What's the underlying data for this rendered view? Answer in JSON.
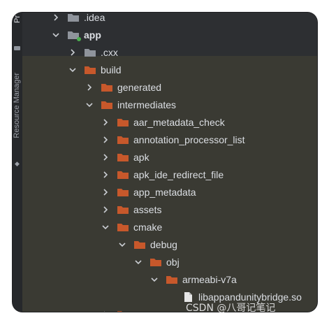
{
  "sidebar": {
    "project_tab": "Pr",
    "resource_manager_tab": "Resource Manager"
  },
  "tree": {
    "items": [
      {
        "label": ".idea",
        "expanded": false,
        "icon": "folder-gray-icon"
      },
      {
        "label": "app",
        "expanded": true,
        "icon": "module-folder-icon"
      },
      {
        "label": ".cxx",
        "expanded": false,
        "icon": "folder-gray-icon"
      },
      {
        "label": "build",
        "expanded": true,
        "icon": "folder-orange-icon"
      },
      {
        "label": "generated",
        "expanded": false,
        "icon": "folder-orange-icon"
      },
      {
        "label": "intermediates",
        "expanded": true,
        "icon": "folder-orange-icon"
      },
      {
        "label": "aar_metadata_check",
        "expanded": false,
        "icon": "folder-orange-icon"
      },
      {
        "label": "annotation_processor_list",
        "expanded": false,
        "icon": "folder-orange-icon"
      },
      {
        "label": "apk",
        "expanded": false,
        "icon": "folder-orange-icon"
      },
      {
        "label": "apk_ide_redirect_file",
        "expanded": false,
        "icon": "folder-orange-icon"
      },
      {
        "label": "app_metadata",
        "expanded": false,
        "icon": "folder-orange-icon"
      },
      {
        "label": "assets",
        "expanded": false,
        "icon": "folder-orange-icon"
      },
      {
        "label": "cmake",
        "expanded": true,
        "icon": "folder-orange-icon"
      },
      {
        "label": "debug",
        "expanded": true,
        "icon": "folder-orange-icon"
      },
      {
        "label": "obj",
        "expanded": true,
        "icon": "folder-orange-icon"
      },
      {
        "label": "armeabi-v7a",
        "expanded": true,
        "icon": "folder-orange-icon"
      },
      {
        "label": "libappandunitybridge.so",
        "icon": "file-icon"
      }
    ]
  },
  "colors": {
    "folder_orange": "#c7582b",
    "folder_gray": "#8f949c",
    "module_dot": "#4caf50",
    "tree_bg": "#3a3a33",
    "text": "#dcdfe4"
  },
  "watermark": "CSDN @八哥记笔记"
}
